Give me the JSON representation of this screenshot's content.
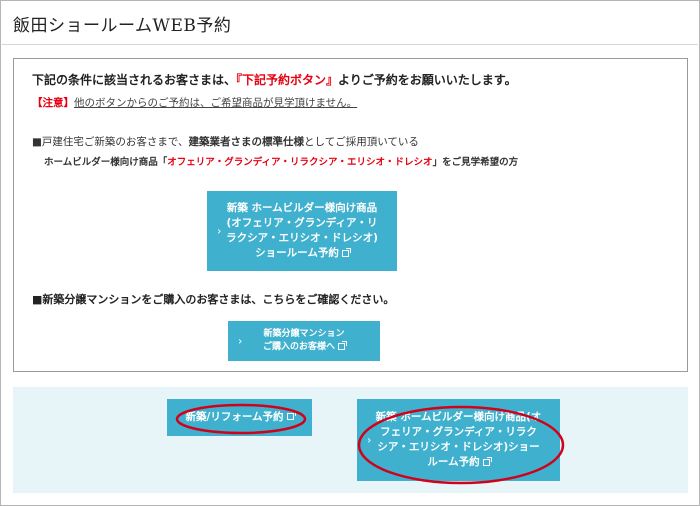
{
  "header": {
    "title": "飯田ショールームWEB予約"
  },
  "notice": {
    "intro_before": "下記の条件に該当されるお客さまは、",
    "intro_highlight": "『下記予約ボタン』",
    "intro_after": "よりご予約をお願いいたします。",
    "caution_tag": "【注意】",
    "caution_text": "他のボタンからのご予約は、ご希望商品が見学頂けません。"
  },
  "section_homebuilder": {
    "line_before": "■戸建住宅ご新築のお客さまで、",
    "line_bold": "建築業者さまの標準仕様",
    "line_after": "としてご採用頂いている",
    "sub_before": "ホームビルダー様向け商品「",
    "sub_highlight": "オフェリア・グランディア・リラクシア・エリシオ・ドレシオ",
    "sub_after": "」をご見学希望の方",
    "button_label": "新築 ホームビルダー様向け商品\n(オフェリア・グランディア・リ\nラクシア・エリシオ・ドレシオ)\nショールーム予約"
  },
  "section_mansion": {
    "line": "■新築分譲マンションをご購入のお客さまは、こちらをご確認ください。",
    "button_label": "新築分譲マンション\nご購入のお客様へ"
  },
  "bottom": {
    "reform_button_label": "新築/リフォーム予約",
    "homebuilder_button_label": "新築 ホームビルダー様向け商品(オ\nフェリア・グランディア・リラク\nシア・エリシオ・ドレシオ)ショー\nルーム予約"
  },
  "icons": {
    "chevron": "chevron-right-icon",
    "external": "external-link-icon"
  },
  "colors": {
    "button": "#3fb0cd",
    "highlight": "#e60012",
    "panel": "#e7f4f8",
    "annotation": "#d0021b"
  }
}
